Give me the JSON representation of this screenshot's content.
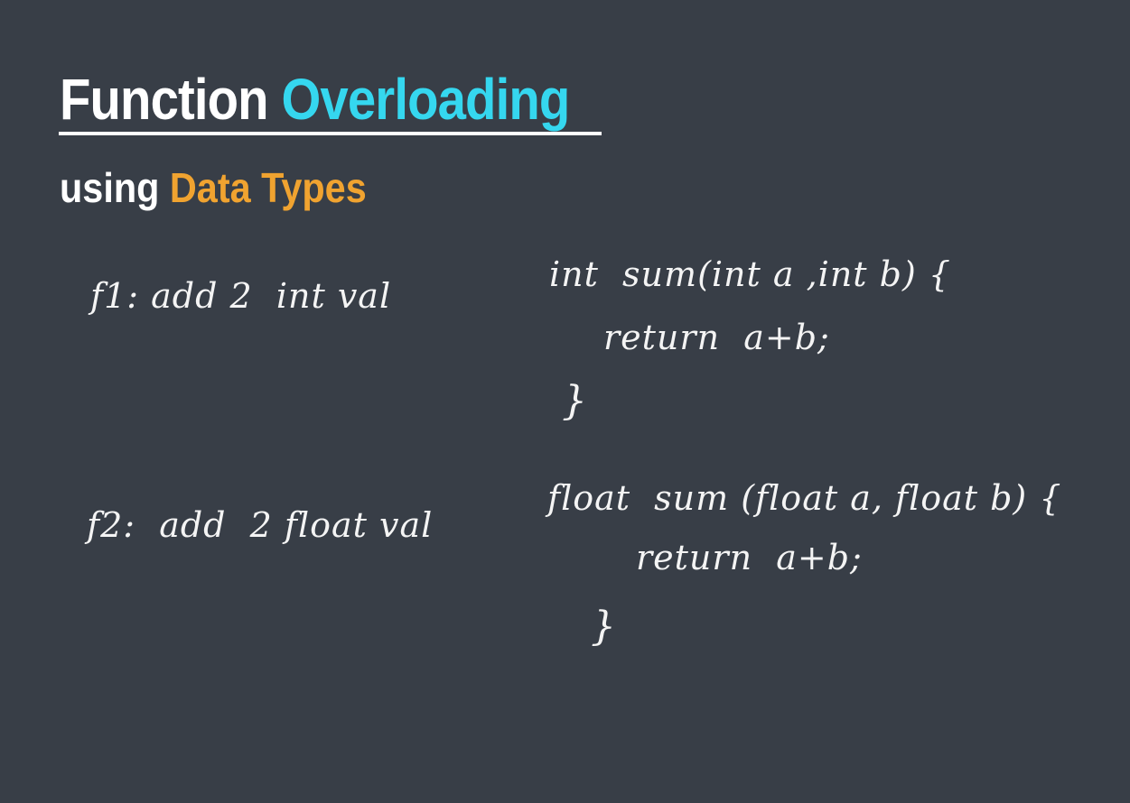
{
  "title": {
    "part1": "Function",
    "part2": "Overloading"
  },
  "subtitle": {
    "part1": "using",
    "part2": "Data Types"
  },
  "notes": {
    "f1_label": "f1: add 2  int val",
    "f1_signature": "int  sum(int a ,int b) {",
    "f1_body": "return  a+b;",
    "f1_close": "}",
    "f2_label": "f2:  add  2 float val",
    "f2_signature": "float  sum (float a, float b) {",
    "f2_body": "return  a+b;",
    "f2_close": "}"
  },
  "colors": {
    "background": "#383e47",
    "title_accent": "#35d7ef",
    "subtitle_accent": "#f0a330",
    "text": "#ffffff"
  }
}
